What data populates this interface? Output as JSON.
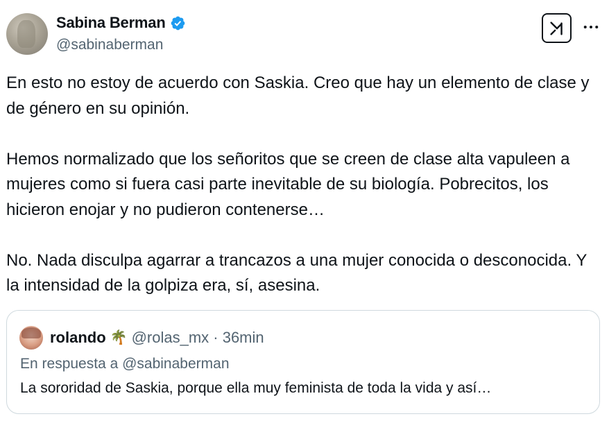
{
  "author": {
    "display_name": "Sabina Berman",
    "handle": "@sabinaberman",
    "verified_icon": "verified-badge-icon"
  },
  "actions": {
    "grok_icon": "grok-icon",
    "more_icon": "more-icon"
  },
  "body": {
    "paragraphs": [
      "En esto no estoy de acuerdo con Saskia. Creo que hay un elemento de clase y de género en su opinión.",
      "Hemos normalizado que los señoritos que se creen de clase alta vapuleen a mujeres como si fuera casi parte inevitable de su biología. Pobrecitos, los hicieron enojar y no pudieron contenerse…",
      "No. Nada disculpa agarrar a trancazos a una mujer conocida o desconocida. Y la intensidad de la golpiza era, sí, asesina."
    ]
  },
  "quote": {
    "name": "rolando",
    "emoji": "🌴",
    "handle_time": "@rolas_mx · 36min",
    "reply_prefix": "En respuesta a ",
    "reply_mention": "@sabinaberman",
    "text": "La sororidad de Saskia, porque ella muy feminista de toda la vida y así…"
  },
  "colors": {
    "text_primary": "#0f1419",
    "text_secondary": "#536471",
    "verified_blue": "#1d9bf0",
    "border": "#cfd9de"
  }
}
